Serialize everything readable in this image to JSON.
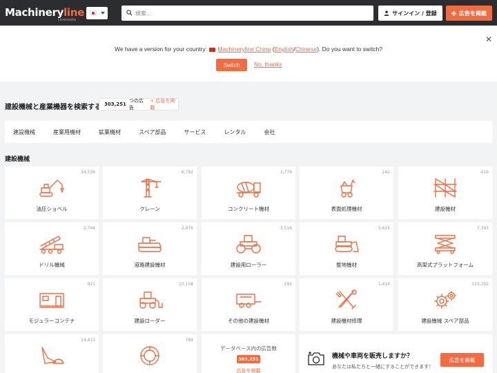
{
  "header": {
    "logo_main": "Machinery",
    "logo_accent": "line",
    "logo_sub": "Linemedia",
    "search_placeholder": "検索...",
    "signin_label": "サインイン / 登録",
    "post_ad_label": "広告を掲載"
  },
  "banner": {
    "msg_prefix": "We have a version for your country:",
    "site_name": "Machineryline China",
    "lang_open": "(",
    "lang_english": "English",
    "lang_sep": "/",
    "lang_chinese": "Chinese",
    "msg_suffix": "). Do you want to switch?",
    "switch_label": "Switch",
    "no_thanks_label": "No, thanks",
    "close_glyph": "✕"
  },
  "page": {
    "title": "建設機械と産業機器を検索する",
    "ad_count": "303,251",
    "ad_count_suffix": "つの広告",
    "post_link": "+ 広告を掲載"
  },
  "tabs": [
    "建設機械",
    "産業用機材",
    "鉱業機材",
    "スペア部品",
    "サービス",
    "レンタル",
    "会社"
  ],
  "section_heading": "建設機械",
  "tiles": [
    {
      "label": "油圧ショベル",
      "count": "34,536",
      "icon": "excavator-icon"
    },
    {
      "label": "クレーン",
      "count": "6,792",
      "icon": "crane-icon"
    },
    {
      "label": "コンクリート機材",
      "count": "3,779",
      "icon": "concrete-mixer-icon"
    },
    {
      "label": "表面処理機材",
      "count": "242",
      "icon": "surface-treatment-icon"
    },
    {
      "label": "建設機材",
      "count": "419",
      "icon": "scaffolding-icon"
    },
    {
      "label": "ドリル機械",
      "count": "2,744",
      "icon": "drilling-rig-icon"
    },
    {
      "label": "道路建設機材",
      "count": "2,976",
      "icon": "paver-icon"
    },
    {
      "label": "建設用ローラー",
      "count": "3,516",
      "icon": "road-roller-icon"
    },
    {
      "label": "整地機材",
      "count": "5,615",
      "icon": "bulldozer-icon"
    },
    {
      "label": "高架式プラットフォーム",
      "count": "7,393",
      "icon": "scissor-lift-icon"
    },
    {
      "label": "モジュラーコンテナ",
      "count": "921",
      "icon": "container-icon"
    },
    {
      "label": "建設ローダー",
      "count": "10,158",
      "icon": "loader-icon"
    },
    {
      "label": "その他の建設機材",
      "count": "292",
      "icon": "trailer-icon"
    },
    {
      "label": "建設機材修理",
      "count": "1,414",
      "icon": "tools-icon"
    },
    {
      "label": "建設機械 スペア部品",
      "count": "115,302",
      "icon": "gears-icon"
    },
    {
      "label": "",
      "count": "14,413",
      "icon": "attachment-icon"
    },
    {
      "label": "",
      "count": "784",
      "icon": "tire-icon"
    }
  ],
  "db_tile": {
    "title": "データベース内の広告数",
    "count": "303,251",
    "link": "広告を掲載"
  },
  "sell": {
    "heading": "機械や車両を販売しますか？",
    "sub": "あなたは私たちと一緒にすることができます！",
    "button": "広告を掲載"
  },
  "colors": {
    "accent": "#f26c3f",
    "header_bg": "#2b2d30",
    "page_bg": "#f2f3f5"
  }
}
